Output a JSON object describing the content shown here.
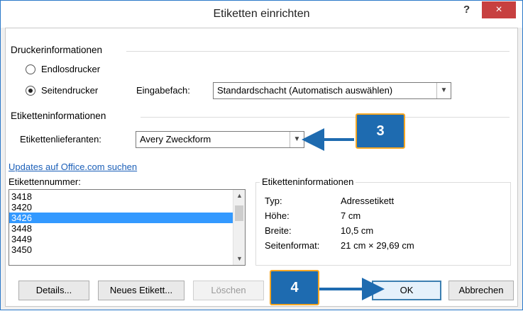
{
  "window": {
    "title": "Etiketten einrichten",
    "help": "?",
    "close": "×"
  },
  "printer": {
    "section": "Druckerinformationen",
    "continuous": "Endlosdrucker",
    "page": "Seitendrucker",
    "selected": "page",
    "tray_label": "Eingabefach:",
    "tray_value": "Standardschacht (Automatisch auswählen)"
  },
  "label_info": {
    "section": "Etiketteninformationen",
    "vendor_label": "Etikettenlieferanten:",
    "vendor_value": "Avery Zweckform",
    "updates_link": "Updates auf Office.com suchen"
  },
  "label_number": {
    "label": "Etikettennummer:",
    "items": [
      "3418",
      "3420",
      "3426",
      "3448",
      "3449",
      "3450"
    ],
    "selected": "3426"
  },
  "details_box": {
    "title": "Etiketteninformationen",
    "rows": [
      {
        "key": "Typ:",
        "value": "Adressetikett"
      },
      {
        "key": "Höhe:",
        "value": "7 cm"
      },
      {
        "key": "Breite:",
        "value": "10,5 cm"
      },
      {
        "key": "Seitenformat:",
        "value": "21 cm × 29,69 cm"
      }
    ]
  },
  "buttons": {
    "details": "Details...",
    "new": "Neues Etikett...",
    "delete": "Löschen",
    "ok": "OK",
    "cancel": "Abbrechen"
  },
  "callouts": {
    "three": "3",
    "four": "4"
  },
  "colors": {
    "accent": "#1e6bb0",
    "callout_border": "#f5a623",
    "close_red": "#c74040",
    "selection": "#3399ff",
    "link": "#1b5fb8"
  }
}
